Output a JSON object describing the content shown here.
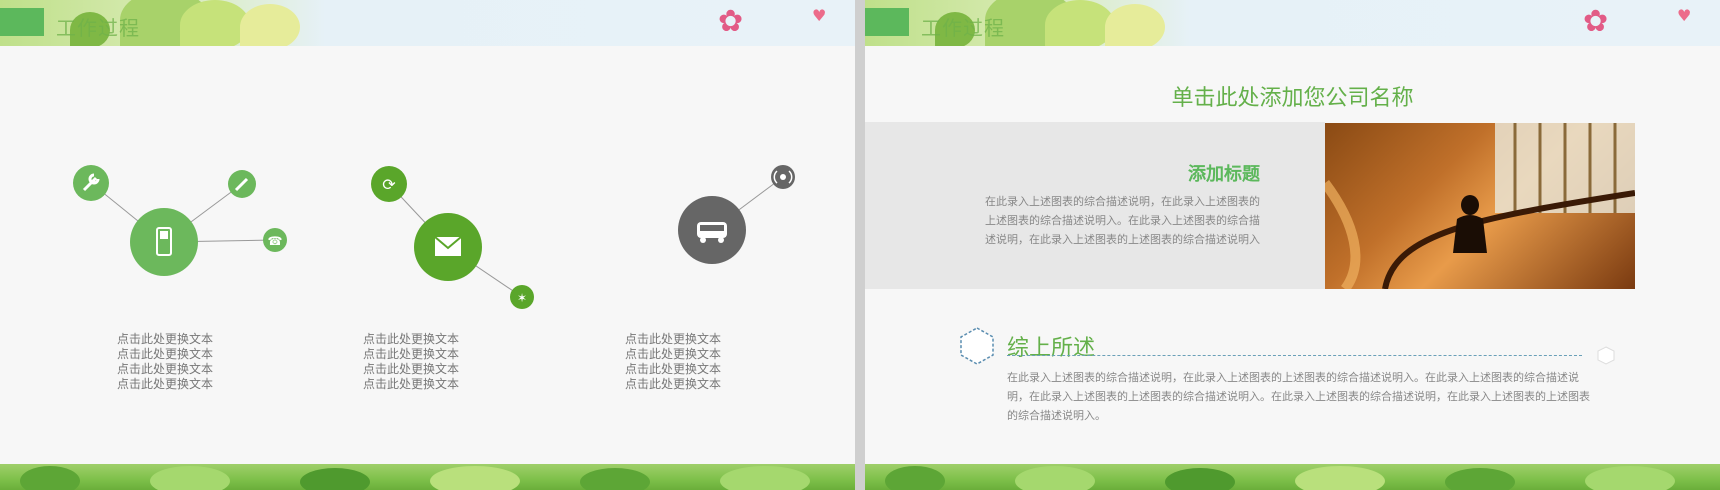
{
  "left_slide": {
    "banner_title": "工作过程",
    "diagrams": [
      {
        "hub_icon": "mobile-phone-icon",
        "hub_color": "#6cb85c",
        "satellites": [
          "wrench-icon",
          "pen-icon",
          "telephone-icon"
        ]
      },
      {
        "hub_icon": "envelope-icon",
        "hub_color": "#5aa62a",
        "satellites": [
          "refresh-icon",
          "runner-icon"
        ]
      },
      {
        "hub_icon": "bus-icon",
        "hub_color": "#666666",
        "satellites": [
          "broadcast-icon"
        ]
      }
    ],
    "captions": [
      [
        "点击此处更换文本",
        "点击此处更换文本",
        "点击此处更换文本",
        "点击此处更换文本"
      ],
      [
        "点击此处更换文本",
        "点击此处更换文本",
        "点击此处更换文本",
        "点击此处更换文本"
      ],
      [
        "点击此处更换文本",
        "点击此处更换文本",
        "点击此处更换文本",
        "点击此处更换文本"
      ]
    ]
  },
  "right_slide": {
    "banner_title": "工作过程",
    "company_name": "单击此处添加您公司名称",
    "add_title": "添加标题",
    "add_body": "在此录入上述图表的综合描述说明，在此录入上述图表的上述图表的综合描述说明入。在此录入上述图表的综合描述说明，在此录入上述图表的上述图表的综合描述说明入",
    "summary_title": "综上所述",
    "summary_body": "在此录入上述图表的综合描述说明，在此录入上述图表的上述图表的综合描述说明入。在此录入上述图表的综合描述说明，在此录入上述图表的上述图表的综合描述说明入。在此录入上述图表的综合描述说明，在此录入上述图表的上述图表的综合描述说明入。"
  },
  "colors": {
    "accent_green": "#64b04a",
    "hub_green_light": "#6cb85c",
    "hub_green_dark": "#5aa62a",
    "hub_grey": "#666666"
  }
}
